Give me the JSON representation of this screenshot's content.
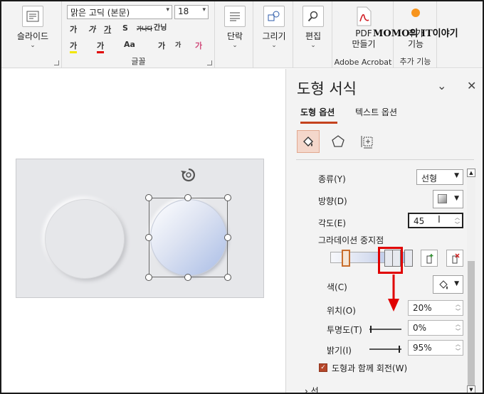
{
  "ribbon": {
    "slides": {
      "label": "슬라이드"
    },
    "font": {
      "name": "맑은 고딕 (본문)",
      "size": "18",
      "group_label": "글꼴",
      "tools_row1": [
        "가",
        "가",
        "가",
        "S",
        "가나다",
        "간닝"
      ],
      "tools_row2": [
        "가",
        "가",
        "Aa",
        "가",
        "가",
        "가"
      ]
    },
    "paragraph": {
      "label": "단락"
    },
    "drawing": {
      "label": "그리기"
    },
    "editing": {
      "label": "편집"
    },
    "pdf": {
      "label_line1": "PDF",
      "label_line2": "만들기",
      "group_label": "Adobe Acrobat"
    },
    "addins": {
      "label_line1": "추가",
      "label_line2": "기능",
      "group_label": "추가 기능"
    },
    "watermark": "MOMO의 IT이야기"
  },
  "panel": {
    "title": "도형 서식",
    "tabs": [
      {
        "label": "도형 옵션",
        "active": true
      },
      {
        "label": "텍스트 옵션",
        "active": false
      }
    ],
    "type_label": "종류(Y)",
    "type_value": "선형",
    "direction_label": "방향(D)",
    "angle_label": "각도(E)",
    "angle_value": "45",
    "gradient_stops_label": "그라데이션 중지점",
    "color_label": "색(C)",
    "position_label": "위치(O)",
    "position_value": "20%",
    "transparency_label": "투명도(T)",
    "transparency_value": "0%",
    "brightness_label": "밝기(I)",
    "brightness_value": "95%",
    "rotate_label": "도형과 함께 회전(W)",
    "rotate_checked": true,
    "next_section": "선"
  },
  "colors": {
    "accent": "#c4421e",
    "highlight_box": "#e00000"
  }
}
